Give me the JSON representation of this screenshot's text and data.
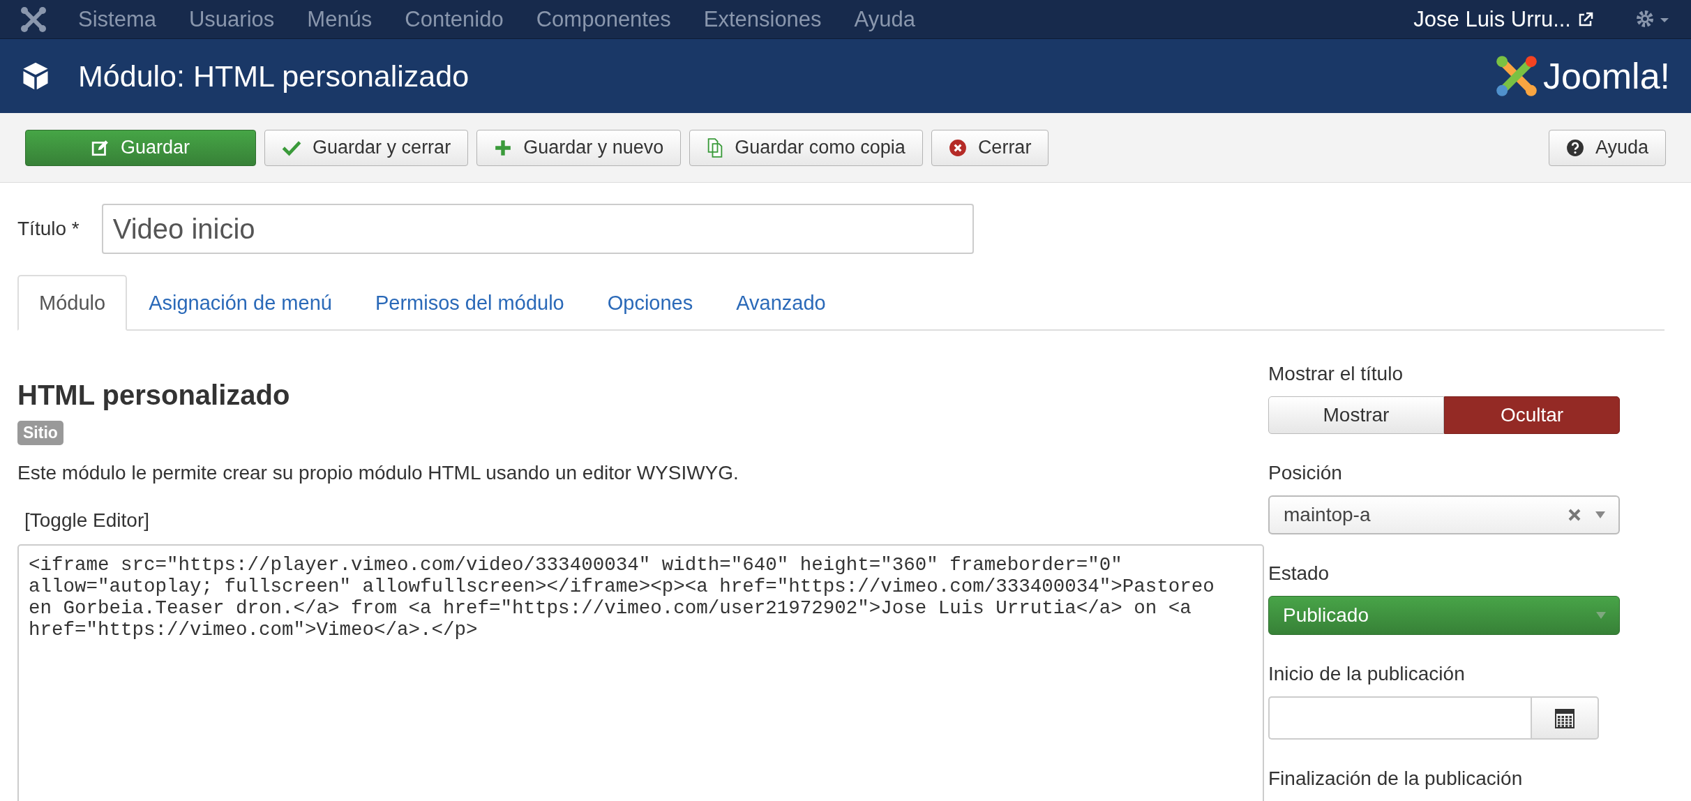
{
  "topnav": {
    "menu": [
      "Sistema",
      "Usuarios",
      "Menús",
      "Contenido",
      "Componentes",
      "Extensiones",
      "Ayuda"
    ],
    "user": "Jose Luis Urru..."
  },
  "header": {
    "title": "Módulo: HTML personalizado",
    "logo_text": "Joomla!"
  },
  "toolbar": [
    {
      "label": "Guardar",
      "kind": "save"
    },
    {
      "label": "Guardar y cerrar",
      "kind": "save-close"
    },
    {
      "label": "Guardar y nuevo",
      "kind": "save-new"
    },
    {
      "label": "Guardar como copia",
      "kind": "copy"
    },
    {
      "label": "Cerrar",
      "kind": "close"
    },
    {
      "label": "Ayuda",
      "kind": "help"
    }
  ],
  "title_field": {
    "label": "Título *",
    "value": "Video inicio"
  },
  "tabs": [
    {
      "label": "Módulo",
      "selected": true
    },
    {
      "label": "Asignación de menú",
      "selected": false
    },
    {
      "label": "Permisos del módulo",
      "selected": false
    },
    {
      "label": "Opciones",
      "selected": false
    },
    {
      "label": "Avanzado",
      "selected": false
    }
  ],
  "module": {
    "heading": "HTML personalizado",
    "badge": "Sitio",
    "description": "Este módulo le permite crear su propio módulo HTML usando un editor WYSIWYG.",
    "toggle": "[Toggle Editor]",
    "code_lines": [
      "<iframe src=\"https://player.vimeo.com/video/333400034\" width=\"640\" height=\"360\" frameborder=\"0\"",
      "allow=\"autoplay; fullscreen\" allowfullscreen></iframe><p><a href=\"https://vimeo.com/333400034\">Pastoreo",
      "en Gorbeia.Teaser dron.</a> from <a href=\"https://vimeo.com/user21972902\">Jose Luis Urrutia</a> on <a",
      "href=\"https://vimeo.com\">Vimeo</a>.</p>"
    ]
  },
  "sidebar": {
    "show_title": {
      "label": "Mostrar el título",
      "options": [
        {
          "label": "Mostrar",
          "selected": false
        },
        {
          "label": "Ocultar",
          "selected": true
        }
      ]
    },
    "position": {
      "label": "Posición",
      "value": "maintop-a"
    },
    "status": {
      "label": "Estado",
      "value": "Publicado"
    },
    "publish_start": {
      "label": "Inicio de la publicación"
    },
    "publish_end": {
      "label": "Finalización de la publicación"
    }
  }
}
